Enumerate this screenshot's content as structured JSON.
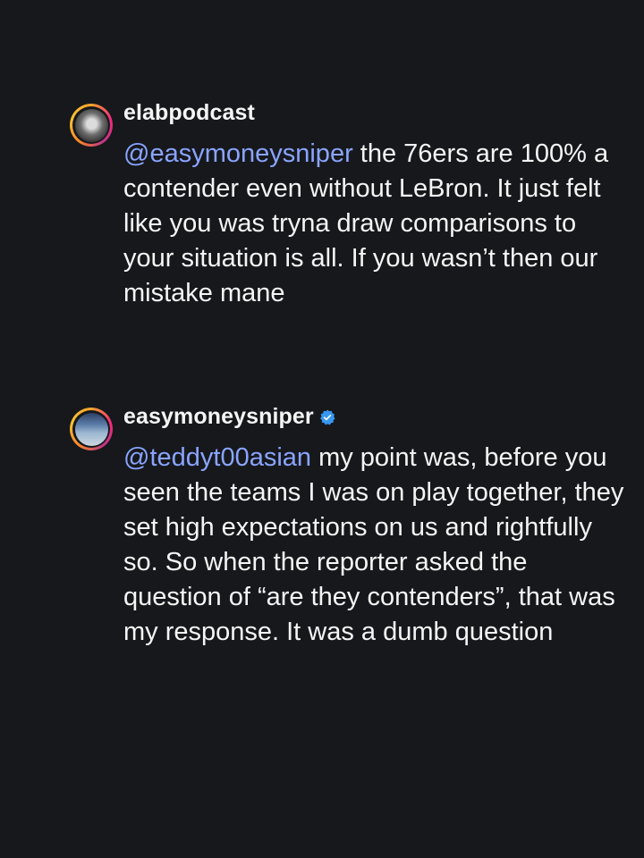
{
  "comments": [
    {
      "username": "elabpodcast",
      "verified": false,
      "mention": "@easymoneysniper",
      "text": " the 76ers are 100% a contender even without LeBron. It just felt like you was tryna draw comparisons to your situation is all. If you wasn’t then our mistake mane"
    },
    {
      "username": "easymoneysniper",
      "verified": true,
      "mention": "@teddyt00asian",
      "text": " my point was, before you seen the teams I was on play together, they set high expectations on us and rightfully so. So when the reporter asked the question of “are they contenders”, that was my response. It was a dumb question"
    }
  ],
  "colors": {
    "background": "#16181c",
    "mention": "#8aa4ff",
    "verified_badge": "#3897f0"
  }
}
